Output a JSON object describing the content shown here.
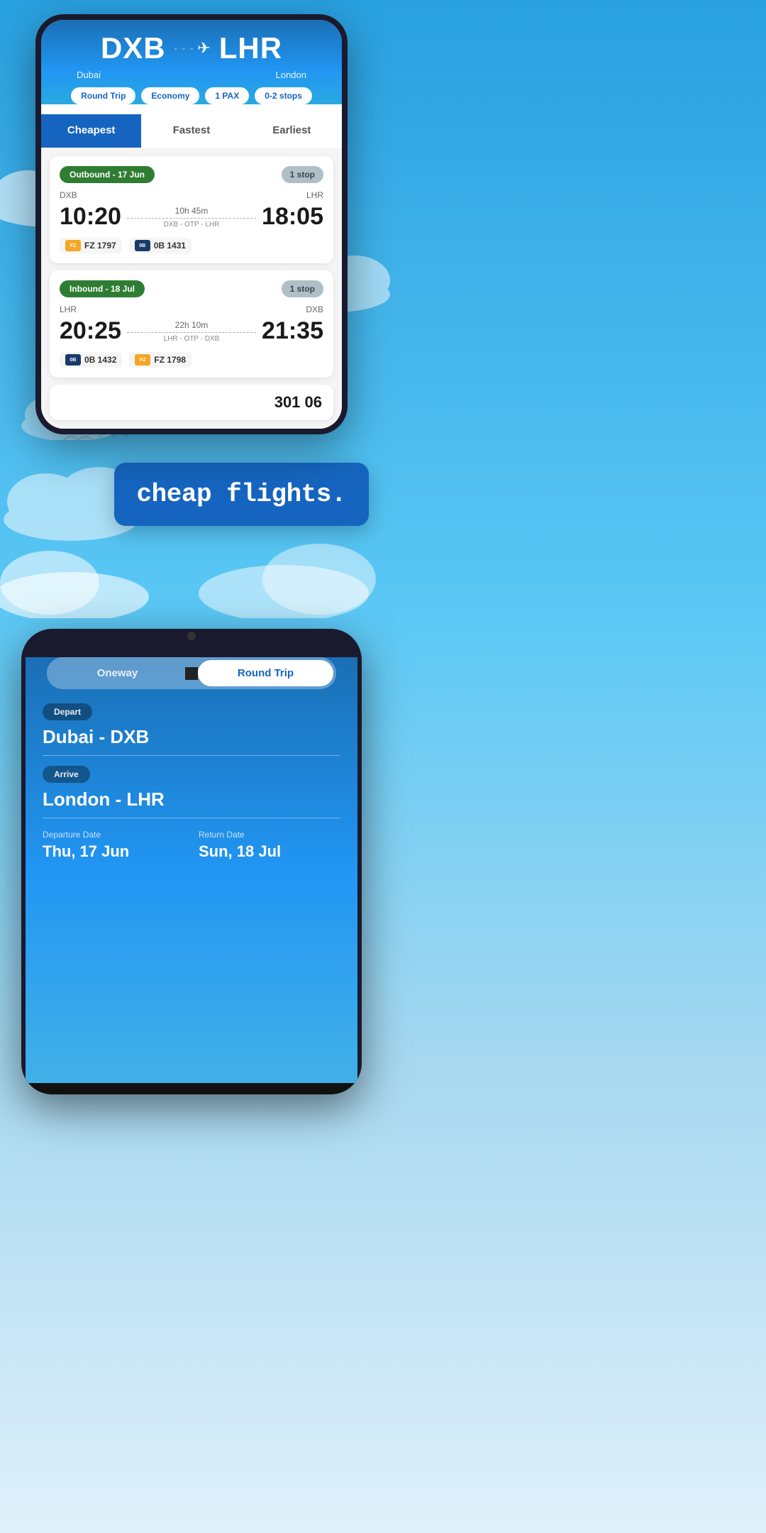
{
  "page": {
    "background": "#2196f3"
  },
  "phone1": {
    "route": {
      "from_code": "DXB",
      "from_name": "Dubai",
      "to_code": "LHR",
      "to_name": "London",
      "arrow": "✈"
    },
    "filters": {
      "trip_type": "Round Trip",
      "cabin": "Economy",
      "pax": "1 PAX",
      "stops": "0-2 stops"
    },
    "tabs": [
      {
        "id": "cheapest",
        "label": "Cheapest",
        "active": true
      },
      {
        "id": "fastest",
        "label": "Fastest",
        "active": false
      },
      {
        "id": "earliest",
        "label": "Earliest",
        "active": false
      }
    ],
    "outbound": {
      "badge": "Outbound - 17 Jun",
      "stops_badge": "1 stop",
      "from": "DXB",
      "to": "LHR",
      "depart_time": "10:20",
      "arrive_time": "18:05",
      "duration": "10h 45m",
      "route_path": "DXB - OTP - LHR",
      "airlines": [
        {
          "code": "FZ 1797",
          "type": "flydubai"
        },
        {
          "code": "0B 1431",
          "type": "blueair"
        }
      ]
    },
    "inbound": {
      "badge": "Inbound - 18 Jul",
      "stops_badge": "1 stop",
      "from": "LHR",
      "to": "DXB",
      "depart_time": "20:25",
      "arrive_time": "21:35",
      "duration": "22h 10m",
      "route_path": "LHR - OTP - DXB",
      "airlines": [
        {
          "code": "0B 1432",
          "type": "blueair"
        },
        {
          "code": "FZ 1798",
          "type": "flydubai"
        }
      ]
    }
  },
  "middle": {
    "tagline": "cheap flights."
  },
  "phone2": {
    "trip_toggle": {
      "oneway": "Oneway",
      "round_trip": "Round Trip"
    },
    "depart": {
      "label": "Depart",
      "value": "Dubai - DXB"
    },
    "arrive": {
      "label": "Arrive",
      "value": "London - LHR"
    },
    "departure_date": {
      "label": "Departure Date",
      "value": "Thu, 17 Jun"
    },
    "return_date": {
      "label": "Return Date",
      "value": "Sun, 18 Jul"
    }
  }
}
